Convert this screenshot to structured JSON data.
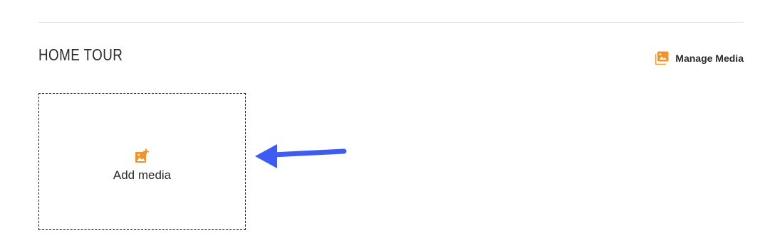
{
  "section": {
    "title": "HOME TOUR"
  },
  "manage_media": {
    "label": "Manage Media",
    "icon": "photo-library-icon"
  },
  "add_media": {
    "label": "Add media",
    "icon": "add-photo-icon"
  },
  "annotation": {
    "icon": "arrow-pointer-icon"
  },
  "colors": {
    "accent": "#f0932b",
    "arrow": "#3f5cf0",
    "text": "#2b2b2b",
    "divider": "#e2e2e2"
  }
}
